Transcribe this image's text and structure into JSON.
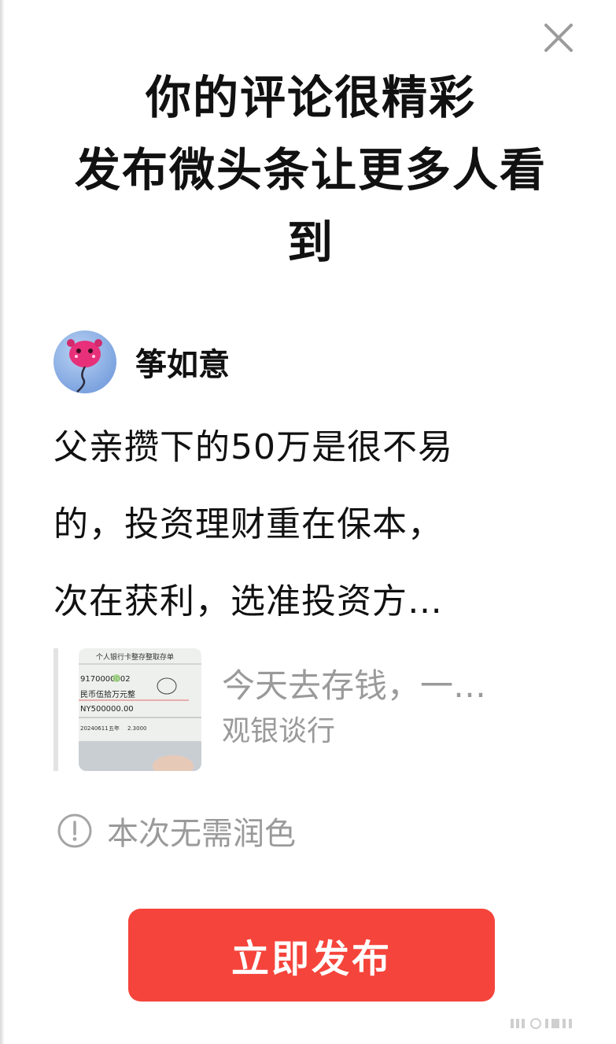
{
  "dialog": {
    "title_lines": [
      "你的评论很精彩",
      "发布微头条让更多人看",
      "到"
    ],
    "close_icon": "close-icon"
  },
  "author": {
    "name": "筝如意",
    "avatar_icon": "kite-avatar"
  },
  "comment": {
    "lines": [
      "父亲攒下的50万是很不易",
      "的，投资理财重在保本，",
      "次在获利，选准投资方…"
    ]
  },
  "quoted_post": {
    "title": "今天去存钱，一…",
    "source": "观银谈行",
    "thumbnail": {
      "bank_name": "个人银行卡整存整取存单",
      "account": "9170000002",
      "amount_words": "民币伍拾万元整",
      "amount": "NY500000.00",
      "row_date": "20240611",
      "row_term": "五年",
      "row_rate": "2.3000"
    }
  },
  "notice": {
    "icon": "info-icon",
    "text": "本次无需润色"
  },
  "actions": {
    "publish_label": "立即发布"
  },
  "colors": {
    "accent": "#f5443b",
    "muted_text": "#9a9a9a",
    "primary_text": "#111111"
  }
}
